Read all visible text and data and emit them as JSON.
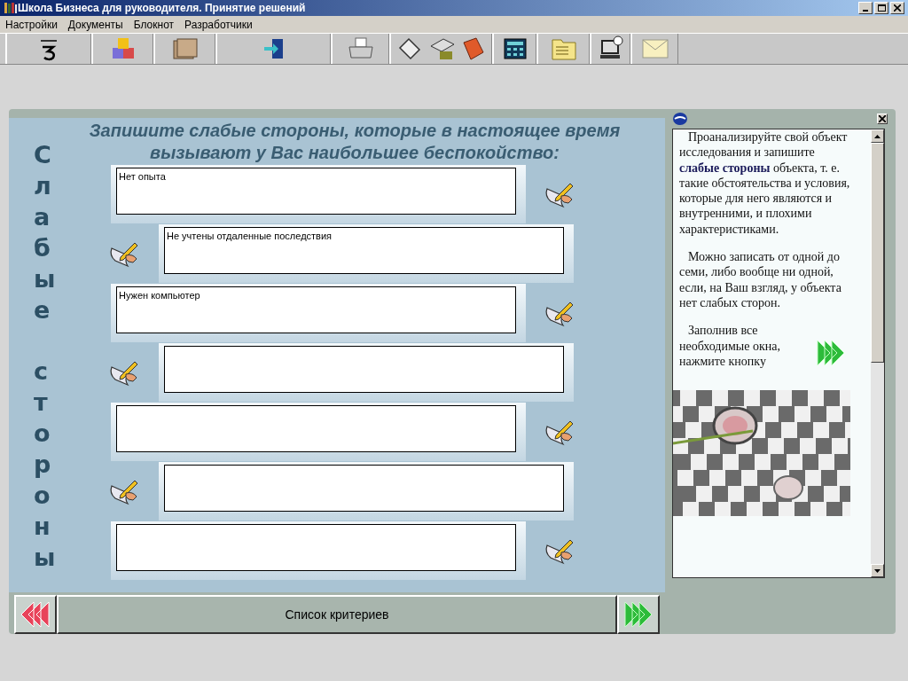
{
  "window": {
    "title": "Школа Бизнеса для руководителя. Принятие решений"
  },
  "menu": [
    {
      "label": "Настройки"
    },
    {
      "label": "Документы"
    },
    {
      "label": "Блокнот"
    },
    {
      "label": "Разработчики"
    }
  ],
  "heading": "Запишите слабые стороны, которые в настоящее время вызывают у Вас наибольшее беспокойство:",
  "side_label": [
    "Слабые",
    "стороны"
  ],
  "entries": [
    {
      "kind": "filled",
      "value": "Нет опыта"
    },
    {
      "kind": "filled",
      "value": "Не учтены отдаленные последствия"
    },
    {
      "kind": "filled",
      "value": "Нужен компьютер"
    },
    {
      "kind": "blank"
    },
    {
      "kind": "blank"
    },
    {
      "kind": "blank"
    },
    {
      "kind": "blank"
    }
  ],
  "footer": {
    "label": "Список критериев"
  },
  "help": {
    "paragraphs": [
      "Проанализируйте свой объект исследования и запишите **слабые стороны** объекта, т. е. такие обстоятельства и условия, которые для него являются и внутренними, и плохими характеристиками.",
      "Можно записать от одной до семи, либо вообще ни одной, если, на Ваш взгляд, у объекта нет слабых сторон.",
      "Заполнив все необходимые окна, нажмите кнопку"
    ],
    "picture": {
      "kind": "picture"
    }
  }
}
